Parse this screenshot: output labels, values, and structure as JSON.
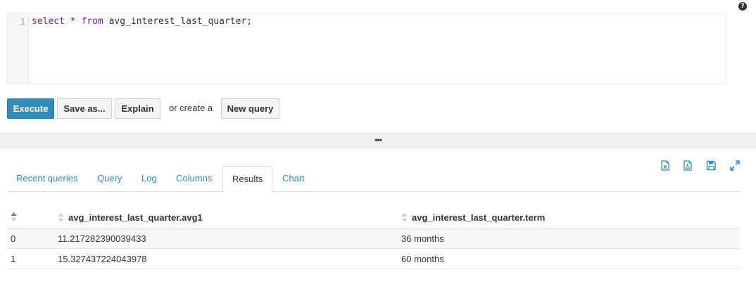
{
  "editor": {
    "line_number": "1",
    "code_kw1": "select",
    "code_mid": " * ",
    "code_kw2": "from",
    "code_rest": " avg_interest_last_quarter;"
  },
  "help": {
    "icon": "question-circle-icon",
    "glyph": "?"
  },
  "toolbar": {
    "execute_label": "Execute",
    "saveas_label": "Save as...",
    "explain_label": "Explain",
    "or_create_text": "or create a",
    "new_query_label": "New query"
  },
  "resizer": {
    "glyph": "•••"
  },
  "result_tools": [
    "export-excel-icon",
    "export-csv-icon",
    "save-icon",
    "expand-icon"
  ],
  "tabs": [
    {
      "label": "Recent queries",
      "active": false
    },
    {
      "label": "Query",
      "active": false
    },
    {
      "label": "Log",
      "active": false
    },
    {
      "label": "Columns",
      "active": false
    },
    {
      "label": "Results",
      "active": true
    },
    {
      "label": "Chart",
      "active": false
    }
  ],
  "results": {
    "columns": [
      "",
      "avg_interest_last_quarter.avg1",
      "avg_interest_last_quarter.term"
    ],
    "rows": [
      [
        "0",
        "11.217282390039433",
        "36 months"
      ],
      [
        "1",
        "15.327437224043978",
        "60 months"
      ]
    ]
  },
  "colors": {
    "accent": "#338bb8",
    "execute_bg": "#338bb8",
    "keyword": "#7a1e9a"
  }
}
